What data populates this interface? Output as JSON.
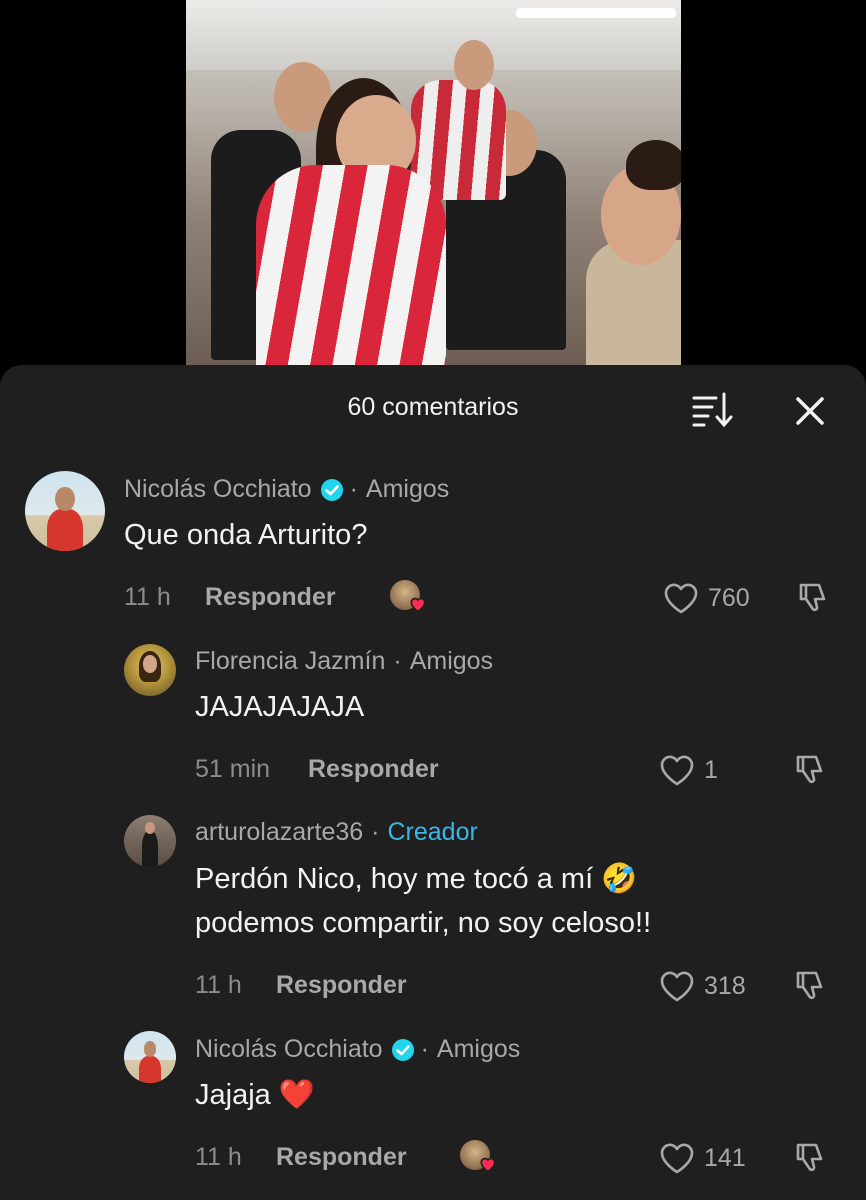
{
  "sheet": {
    "title": "60 comentarios",
    "sort_icon": "sort-icon",
    "close_icon": "close-icon"
  },
  "comments": [
    {
      "author": "Nicolás Occhiato",
      "verified": true,
      "separator": "·",
      "role": "Amigos",
      "text": "Que onda Arturito?",
      "time": "11 h",
      "reply_label": "Responder",
      "liked_by_creator": true,
      "likes": "760"
    },
    {
      "author": "Florencia Jazmín",
      "verified": false,
      "separator": "·",
      "role": "Amigos",
      "text": "JAJAJAJAJA",
      "time": "51 min",
      "reply_label": "Responder",
      "liked_by_creator": false,
      "likes": "1"
    },
    {
      "author": "arturolazarte36",
      "verified": false,
      "separator": "·",
      "role": "Creador",
      "text_line1": "Perdón Nico, hoy me tocó a mí 🤣",
      "text_line2": "podemos compartir, no soy celoso!!",
      "time": "11 h",
      "reply_label": "Responder",
      "liked_by_creator": false,
      "likes": "318"
    },
    {
      "author": "Nicolás Occhiato",
      "verified": true,
      "separator": "·",
      "role": "Amigos",
      "text": "Jajaja ❤️",
      "time": "11 h",
      "reply_label": "Responder",
      "liked_by_creator": true,
      "likes": "141"
    }
  ],
  "colors": {
    "sheet_bg": "#1f1f1f",
    "creator_role": "#3ab7e8",
    "verified_badge": "#20d5ec",
    "liked_heart": "#fe2c55"
  }
}
